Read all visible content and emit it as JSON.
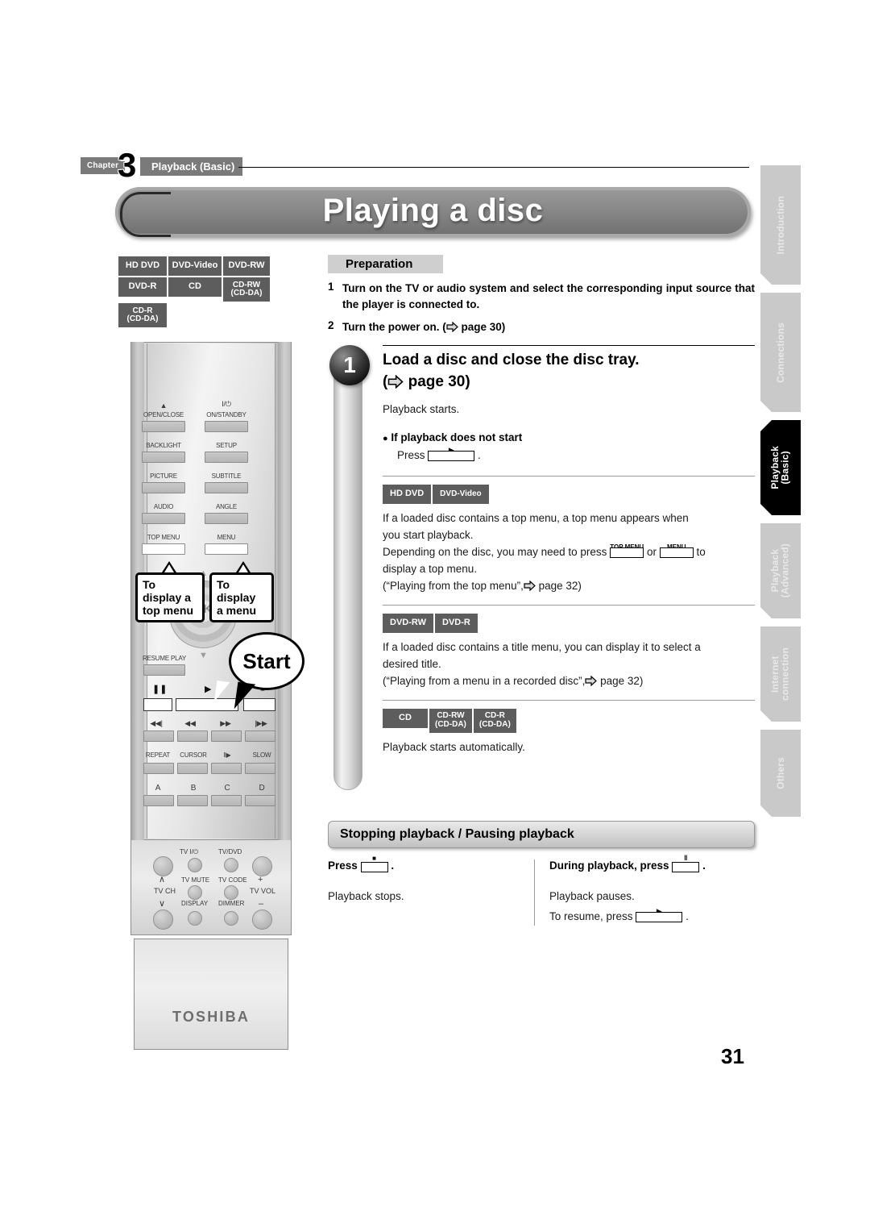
{
  "chapter": {
    "label": "Chapter",
    "number": "3",
    "title": "Playback (Basic)"
  },
  "banner": {
    "title": "Playing a disc"
  },
  "disc_badges_top": [
    [
      "HD DVD",
      "DVD-Video",
      "DVD-RW"
    ],
    [
      "DVD-R",
      "CD",
      "CD-RW\n(CD-DA)"
    ],
    [
      "CD-R\n(CD-DA)"
    ]
  ],
  "side_tabs": [
    {
      "label": "Introduction",
      "active": false
    },
    {
      "label": "Connections",
      "active": false
    },
    {
      "label": "Playback\n(Basic)",
      "active": true
    },
    {
      "label": "Playback\n(Advanced)",
      "active": false
    },
    {
      "label": "Internet\nconnection",
      "active": false
    },
    {
      "label": "Others",
      "active": false
    }
  ],
  "preparation": {
    "heading": "Preparation",
    "items": [
      {
        "n": "1",
        "text": "Turn on the TV or audio system and select the corresponding input source that the player is connected to."
      },
      {
        "n": "2",
        "text": "Turn the power on. (",
        "text_after": "page 30)"
      }
    ]
  },
  "step1": {
    "number": "1",
    "title_line1": "Load a disc and close the disc tray.",
    "title_line2_prefix": "(",
    "title_line2_suffix": "page 30)",
    "body": "Playback starts.",
    "sub_heading": "If playback does not start",
    "press_label": "Press",
    "press_period": ".",
    "blocks": [
      {
        "badges": [
          "HD DVD",
          "DVD-Video"
        ],
        "lines": [
          "If a loaded disc contains a top menu, a top menu appears when",
          "you start playback."
        ],
        "inline_prefix": "Depending on the disc, you may need to press",
        "key1": "TOP MENU",
        "inline_mid": "or",
        "key2": "MENU",
        "inline_suffix": "to",
        "line_after": "display a top menu.",
        "ref_prefix": "(“Playing from the top menu”,",
        "ref_suffix": "page 32)"
      },
      {
        "badges": [
          "DVD-RW",
          "DVD-R"
        ],
        "lines": [
          "If a loaded disc contains a title menu, you can display it to select a",
          "desired title."
        ],
        "ref_prefix": "(“Playing from a menu in a recorded disc”,",
        "ref_suffix": "page 32)"
      },
      {
        "badges": [
          "CD",
          "CD-RW\n(CD-DA)",
          "CD-R\n(CD-DA)"
        ],
        "lines": [
          "Playback starts automatically."
        ]
      }
    ]
  },
  "stopping": {
    "heading": "Stopping playback / Pausing playback",
    "left": {
      "press_label": "Press",
      "key_glyph": "■",
      "period": ".",
      "result": "Playback stops."
    },
    "right": {
      "press_label": "During playback, press",
      "key_glyph": "‖",
      "period": ".",
      "result1": "Playback pauses.",
      "result2_prefix": "To resume, press",
      "result2_period": "."
    }
  },
  "remote": {
    "brand": "TOSHIBA",
    "left_buttons": [
      {
        "label": "OPEN/CLOSE",
        "glyph": "▲"
      },
      {
        "label": "BACKLIGHT",
        "glyph": ""
      },
      {
        "label": "PICTURE",
        "glyph": ""
      },
      {
        "label": "AUDIO",
        "glyph": ""
      },
      {
        "label": "TOP MENU",
        "glyph": "",
        "white": true
      }
    ],
    "right_buttons": [
      {
        "label": "ON/STANDBY",
        "glyph": "I/⏻"
      },
      {
        "label": "SETUP",
        "glyph": ""
      },
      {
        "label": "SUBTITLE",
        "glyph": ""
      },
      {
        "label": "ANGLE",
        "glyph": ""
      },
      {
        "label": "MENU",
        "glyph": "",
        "white": true
      }
    ],
    "ok_label": "OK",
    "resume_label": "RESUME PLAY",
    "transport_glyphs": [
      "‖",
      "▶",
      "■"
    ],
    "skip_glyphs": [
      "◀◀|",
      "◀◀",
      "▶▶",
      "|▶▶"
    ],
    "function_labels": [
      "REPEAT",
      "CURSOR",
      "‖▶",
      "SLOW"
    ],
    "abcd_labels": [
      "A",
      "B",
      "C",
      "D"
    ],
    "tv_labels": {
      "tv_power": "TV I/⏻",
      "tv_dvd": "TV/DVD",
      "tv_mute": "TV MUTE",
      "tv_code": "TV CODE",
      "display": "DISPLAY",
      "dimmer": "DIMMER",
      "tv_ch": "TV CH",
      "tv_vol": "TV VOL",
      "plus": "+",
      "minus": "–",
      "up": "∧",
      "down": "∨"
    },
    "callouts": [
      {
        "line1": "To display a",
        "line2": "top menu"
      },
      {
        "line1": "To display",
        "line2": "a menu"
      }
    ],
    "start_bubble": "Start"
  },
  "page_number": "31"
}
